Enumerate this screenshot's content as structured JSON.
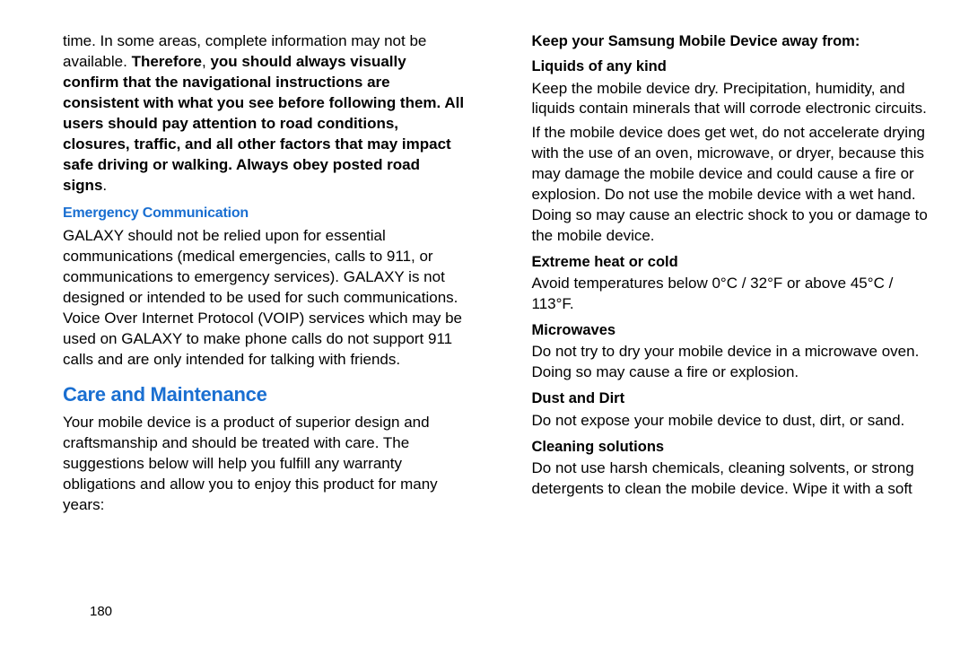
{
  "left": {
    "top_p1_a": "time. In some areas, complete information may not be available. ",
    "top_p1_b_bold": "Therefore",
    "top_p1_c": ", ",
    "top_p1_d_bold": "you should always visually confirm that the navigational instructions are consistent with what you see before following them. All users should pay attention to road conditions, closures, traffic, and all other factors that may impact safe driving or walking. Always obey posted road signs",
    "top_p1_e": ".",
    "subhead1": "Emergency Communication",
    "p2": "GALAXY should not be relied upon for essential communications (medical emergencies, calls to 911, or communications to emergency services). GALAXY is not designed or intended to be used for such communications. Voice Over Internet Protocol (VOIP) services which may be used on GALAXY to make phone calls do not support 911 calls and are only intended for talking with friends.",
    "section1": "Care and Maintenance",
    "p3": "Your mobile device is a product of superior design and craftsmanship and should be treated with care. The suggestions below will help you fulfill any warranty obligations and allow you to enjoy this product for many years:"
  },
  "right": {
    "h1": "Keep your Samsung Mobile Device away from:",
    "h2": "Liquids of any kind",
    "p1": "Keep the mobile device dry. Precipitation, humidity, and liquids contain minerals that will corrode electronic circuits.",
    "p2": "If the mobile device does get wet, do not accelerate drying with the use of an oven, microwave, or dryer, because this may damage the mobile device and could cause a fire or explosion. Do not use the mobile device with a wet hand. Doing so may cause an electric shock to you or damage to the mobile device.",
    "h3": "Extreme heat or cold",
    "p3": "Avoid temperatures below 0°C / 32°F or above 45°C / 113°F.",
    "h4": "Microwaves",
    "p4": "Do not try to dry your mobile device in a microwave oven. Doing so may cause a fire or explosion.",
    "h5": "Dust and Dirt",
    "p5": "Do not expose your mobile device to dust, dirt, or sand.",
    "h6": "Cleaning solutions",
    "p6": "Do not use harsh chemicals, cleaning solvents, or strong detergents to clean the mobile device. Wipe it with a soft"
  },
  "page_number": "180"
}
